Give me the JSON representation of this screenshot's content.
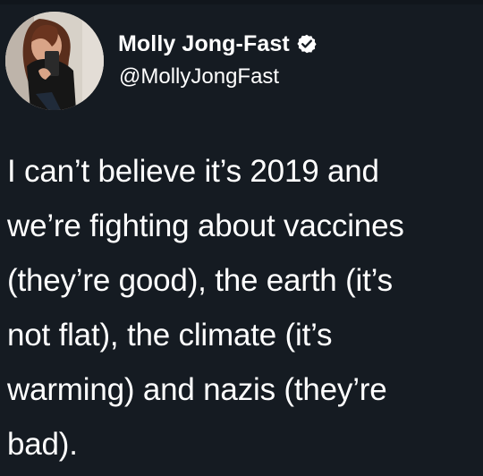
{
  "tweet": {
    "author_name": "Molly Jong-Fast",
    "handle": "@MollyJongFast",
    "verified_icon": "verified-badge-icon",
    "avatar_icon": "profile-photo",
    "text": "I can’t believe it’s 2019 and\nwe’re fighting about vaccines\n(they’re good), the earth (it’s\nnot flat), the climate (it’s\nwarming) and nazis (they’re\nbad)."
  },
  "colors": {
    "background": "#151b22",
    "text": "#ffffff"
  }
}
